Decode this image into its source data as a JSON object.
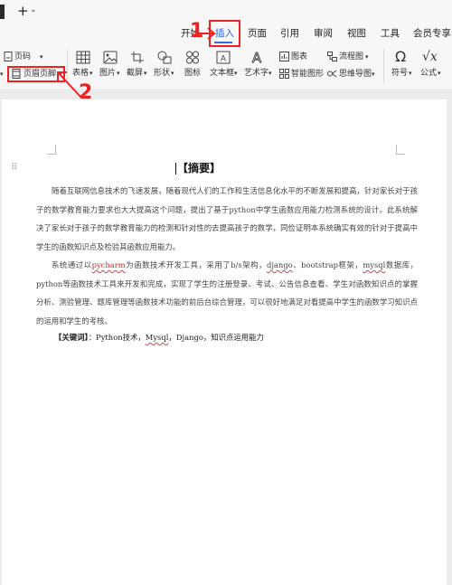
{
  "titlebar": {
    "new_tab": "+",
    "new_tab_menu": "⌄"
  },
  "ribbon_tabs": [
    {
      "label": "开始",
      "active": false
    },
    {
      "label": "插入",
      "active": true
    },
    {
      "label": "页面",
      "active": false
    },
    {
      "label": "引用",
      "active": false
    },
    {
      "label": "审阅",
      "active": false
    },
    {
      "label": "视图",
      "active": false
    },
    {
      "label": "工具",
      "active": false
    },
    {
      "label": "会员专享",
      "active": false
    }
  ],
  "toolbar": {
    "page_number": "页码",
    "header_footer": "页眉页脚",
    "table": "表格",
    "picture": "图片",
    "screenshot": "截屏",
    "shape": "形状",
    "icon": "图标",
    "textbox": "文本框",
    "wordart": "艺术字",
    "chart": "图表",
    "smart_graphic": "智能图形",
    "flowchart": "流程图",
    "mindmap": "思维导图",
    "symbol": "符号",
    "formula": "公式"
  },
  "annotations": {
    "step1": "1",
    "step2": "2"
  },
  "document": {
    "title": "【摘要】",
    "p1": "随着互联网信息技术的飞速发展，随着现代人们的工作和生活信息化水平的不断发展和提高，针对家长对于孩子的数学教育能力要求也大大提高这个问题，提出了基于python中学生函数应用能力检测系统的设计。此系统解决了家长对于孩子的数学教育能力的检测和针对性的去提高孩子的数学，同俭证明本系统确实有效的针对于提高中学生的函数知识点及检验其函数应用能力。",
    "p2_a": "系统通过以",
    "p2_pycharm": "pycharm",
    "p2_b": "为函数技术开发工具，采用了b/s架构，",
    "p2_django": "django",
    "p2_c": "、bootstrap框架，",
    "p2_mysql": "mysql",
    "p2_d": "数据库，python等函数技术工具来开发和完成，实现了学生的注册登录、考试、公告信息查看、学生对函数知识点的掌握分析、测验管理、题库管理等函数技术功能的前后台综合管理，可以很好地满足对看提高中学生的函数学习知识点的运用和学生的考核。",
    "kw_label": "【关键词】",
    "kw_a": "：Python技术，",
    "kw_mysql": "Mysql",
    "kw_b": "，Django，知识点运用能力"
  }
}
